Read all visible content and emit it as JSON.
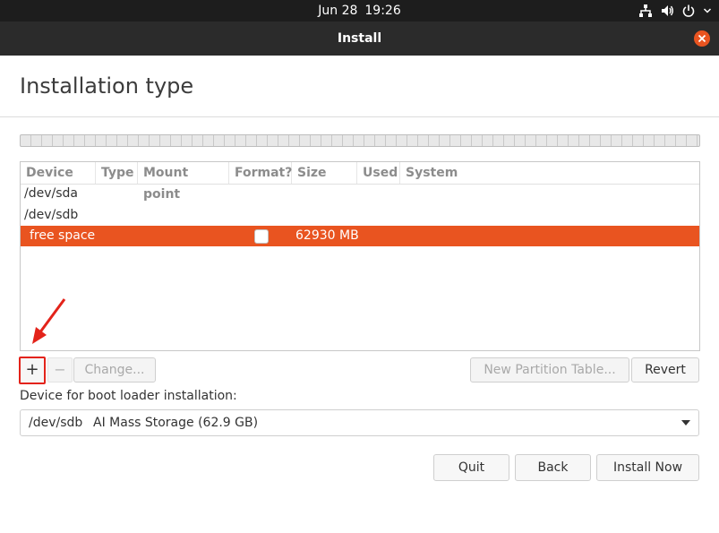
{
  "topbar": {
    "date": "Jun 28",
    "time": "19:26"
  },
  "window": {
    "title": "Install"
  },
  "page": {
    "title": "Installation type"
  },
  "table": {
    "columns": [
      "Device",
      "Type",
      "Mount point",
      "Format?",
      "Size",
      "Used",
      "System"
    ],
    "rows": [
      {
        "device": "/dev/sda"
      },
      {
        "device": "/dev/sdb"
      },
      {
        "device": "free space",
        "size": "62930 MB",
        "selected": true,
        "format_checked": false
      }
    ]
  },
  "buttons": {
    "add": "+",
    "remove": "−",
    "change": "Change...",
    "new_partition_table": "New Partition Table...",
    "revert": "Revert",
    "quit": "Quit",
    "back": "Back",
    "install_now": "Install Now"
  },
  "boot_loader": {
    "label": "Device for boot loader installation:",
    "device": "/dev/sdb",
    "description": "AI Mass Storage (62.9 GB)"
  },
  "colors": {
    "accent": "#e95420",
    "highlight": "#e3231a",
    "topbar": "#1d1d1d",
    "titlebar": "#2b2b2b"
  },
  "icons": [
    "network-icon",
    "volume-icon",
    "power-icon",
    "chevron-down-icon",
    "close-icon",
    "arrow-icon",
    "dropdown-icon"
  ]
}
